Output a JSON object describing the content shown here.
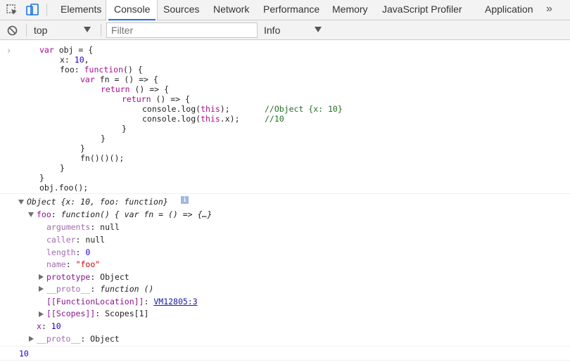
{
  "tabs": {
    "elements": "Elements",
    "console": "Console",
    "sources": "Sources",
    "network": "Network",
    "performance": "Performance",
    "memory": "Memory",
    "profiler": "JavaScript Profiler",
    "application": "Application",
    "more": "»"
  },
  "toolbar": {
    "context": "top",
    "filter_placeholder": "Filter",
    "level": "Info"
  },
  "code": {
    "l1a": "var",
    "l1b": " obj = {",
    "l2a": "x: ",
    "l2b": "10",
    "l2c": ",",
    "l3a": "foo: ",
    "l3b": "function",
    "l3c": "() {",
    "l4a": "var",
    "l4b": " fn = () => {",
    "l5a": "return",
    "l5b": " () => {",
    "l6a": "return",
    "l6b": " () => {",
    "l7a": "console.log(",
    "l7b": "this",
    "l7c": ");",
    "l7d": "//Object {x: 10}",
    "l8a": "console.log(",
    "l8b": "this",
    "l8c": ".x);",
    "l8d": "//10",
    "l9": "}",
    "l10": "}",
    "l11": "}",
    "l12": "fn()()();",
    "l13": "}",
    "l14": "}",
    "l15": "obj.foo();"
  },
  "result": {
    "object_summary": "Object {x: 10, foo: function}",
    "info_badge": "i",
    "foo_key": "foo",
    "foo_summary": "function() { var fn = () => {…}",
    "arguments_key": "arguments",
    "arguments_val": "null",
    "caller_key": "caller",
    "caller_val": "null",
    "length_key": "length",
    "length_val": "0",
    "name_key": "name",
    "name_val": "\"foo\"",
    "prototype_key": "prototype",
    "prototype_val": "Object",
    "proto_key": "__proto__",
    "proto_val": "function ()",
    "funcloc_key": "[[FunctionLocation]]",
    "funcloc_val": "VM12805:3",
    "scopes_key": "[[Scopes]]",
    "scopes_val": "Scopes[1]",
    "x_key": "x",
    "x_val": "10",
    "obj_proto_key": "__proto__",
    "obj_proto_val": "Object",
    "log_value": "10"
  }
}
